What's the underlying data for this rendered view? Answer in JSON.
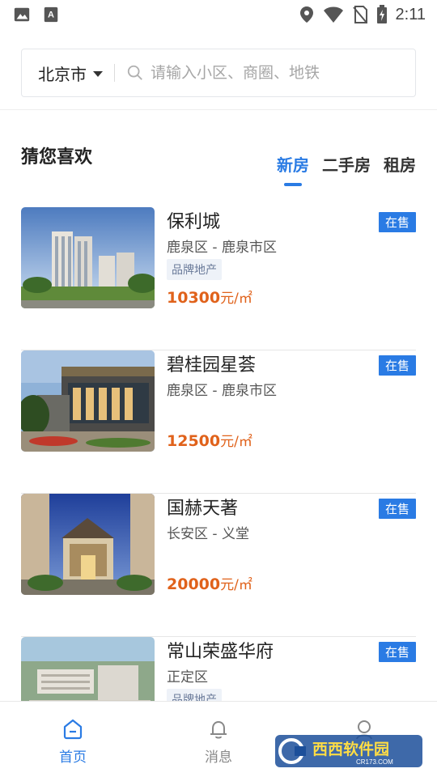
{
  "status_bar": {
    "time": "2:11",
    "left_icons": [
      "image-icon",
      "font-a-icon"
    ],
    "right_icons": [
      "location-icon",
      "wifi-icon",
      "no-sim-icon",
      "battery-charging-icon"
    ]
  },
  "search": {
    "city": "北京市",
    "placeholder": "请输入小区、商圈、地铁"
  },
  "section": {
    "title": "猜您喜欢",
    "tabs": [
      {
        "label": "新房",
        "active": true
      },
      {
        "label": "二手房",
        "active": false
      },
      {
        "label": "租房",
        "active": false
      }
    ]
  },
  "listings": [
    {
      "name": "保利城",
      "location": "鹿泉区 - 鹿泉市区",
      "tag": "品牌地产",
      "price": "10300",
      "unit": "元/㎡",
      "status": "在售"
    },
    {
      "name": "碧桂园星荟",
      "location": "鹿泉区 - 鹿泉市区",
      "tag": "",
      "price": "12500",
      "unit": "元/㎡",
      "status": "在售"
    },
    {
      "name": "国赫天著",
      "location": "长安区 - 义堂",
      "tag": "",
      "price": "20000",
      "unit": "元/㎡",
      "status": "在售"
    },
    {
      "name": "常山荣盛华府",
      "location": "正定区",
      "tag": "品牌地产",
      "price": "",
      "unit": "",
      "status": "在售"
    }
  ],
  "bottom_nav": [
    {
      "label": "首页",
      "icon": "home-icon",
      "active": true
    },
    {
      "label": "消息",
      "icon": "bell-icon",
      "active": false
    },
    {
      "label": "",
      "icon": "user-icon",
      "active": false
    }
  ],
  "watermark": {
    "text": "西西软件园",
    "subtext": "CR173.COM"
  },
  "colors": {
    "accent": "#2a7be4",
    "price": "#e0621b",
    "badge_bg": "#2a7be4"
  }
}
